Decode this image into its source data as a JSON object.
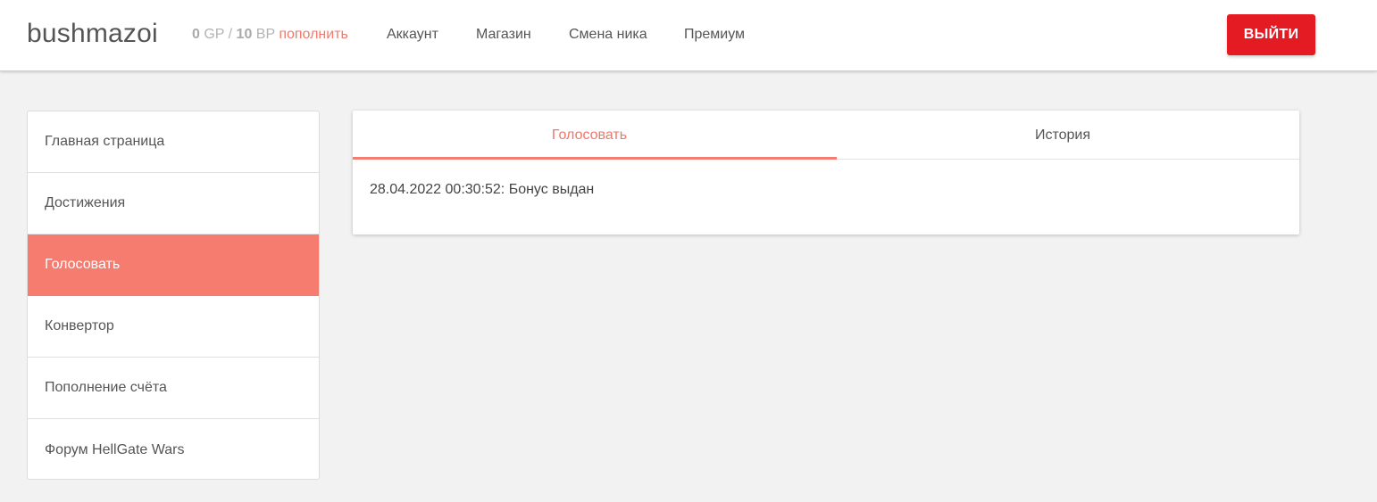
{
  "header": {
    "username": "bushmazoi",
    "balance": {
      "gp_value": "0",
      "gp_unit": "GP",
      "separator": "/",
      "bp_value": "10",
      "bp_unit": "BP",
      "topup_label": "пополнить"
    },
    "nav": [
      "Аккаунт",
      "Магазин",
      "Смена ника",
      "Премиум"
    ],
    "logout_label": "ВЫЙТИ"
  },
  "sidebar": {
    "items": [
      {
        "label": "Главная страница",
        "active": false
      },
      {
        "label": "Достижения",
        "active": false
      },
      {
        "label": "Голосовать",
        "active": true
      },
      {
        "label": "Конвертор",
        "active": false
      },
      {
        "label": "Пополнение счёта",
        "active": false
      },
      {
        "label": "Форум HellGate Wars",
        "active": false
      }
    ]
  },
  "main": {
    "tabs": [
      {
        "label": "Голосовать",
        "active": true
      },
      {
        "label": "История",
        "active": false
      }
    ],
    "entries": [
      "28.04.2022 00:30:52: Бонус выдан"
    ]
  },
  "colors": {
    "accent": "#f77c70",
    "logout": "#e51b24",
    "background": "#f2f2f2"
  }
}
